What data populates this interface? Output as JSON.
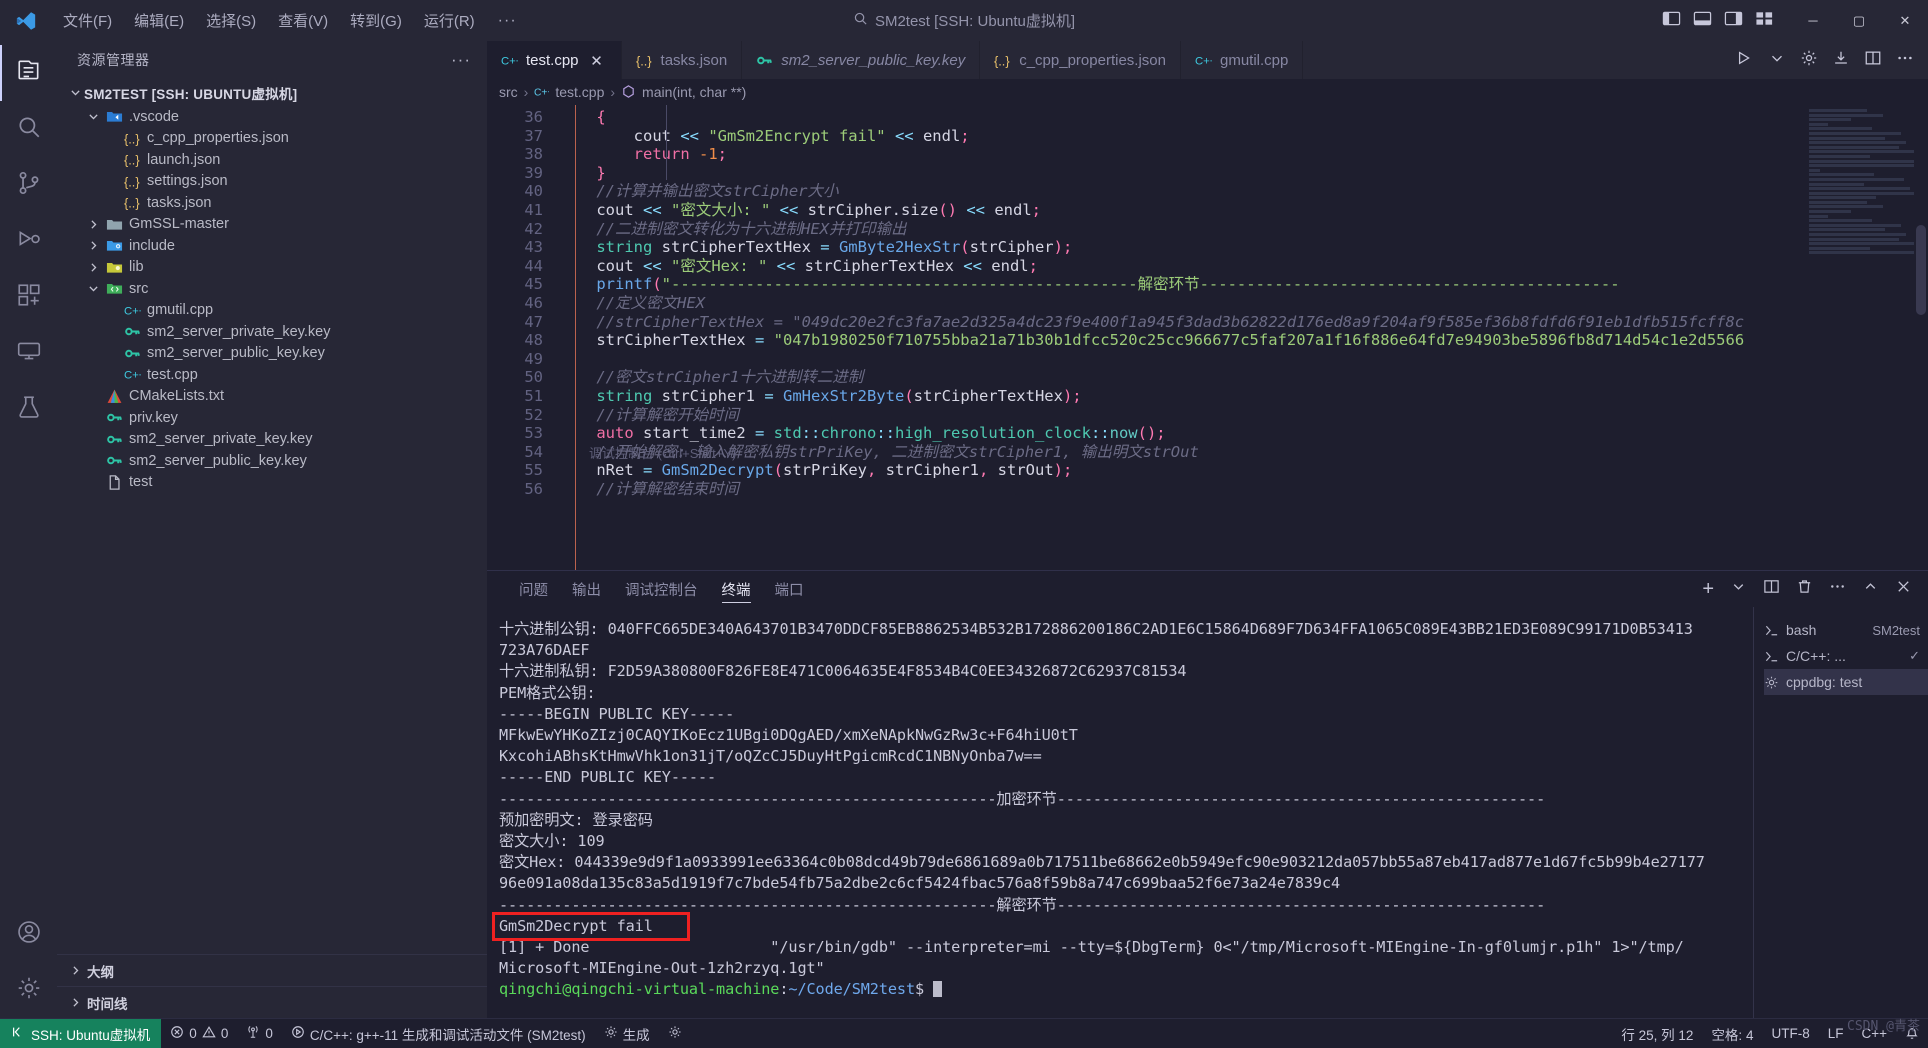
{
  "titlebar": {
    "menus": [
      "文件(F)",
      "编辑(E)",
      "选择(S)",
      "查看(V)",
      "转到(G)",
      "运行(R)"
    ],
    "more": "···",
    "center_title": "SM2test [SSH: Ubuntu虚拟机]",
    "search_icon": "search-icon",
    "window_buttons": {
      "minimize": "─",
      "maximize": "▢",
      "close": "✕"
    }
  },
  "activitybar": {
    "items": [
      {
        "name": "explorer",
        "icon": "files-icon",
        "active": true
      },
      {
        "name": "search",
        "icon": "search-icon",
        "active": false
      },
      {
        "name": "source-control",
        "icon": "source-control-icon",
        "active": false
      },
      {
        "name": "run-and-debug",
        "icon": "run-debug-icon",
        "active": false
      },
      {
        "name": "extensions",
        "icon": "extensions-icon",
        "active": false
      },
      {
        "name": "remote-explorer",
        "icon": "remote-explorer-icon",
        "active": false
      },
      {
        "name": "testing",
        "icon": "beaker-icon",
        "active": false
      }
    ],
    "bottom": [
      {
        "name": "accounts",
        "icon": "account-icon"
      },
      {
        "name": "manage",
        "icon": "gear-icon"
      }
    ]
  },
  "sidebar": {
    "title": "资源管理器",
    "more_actions": "···",
    "root": {
      "label": "SM2TEST [SSH: UBUNTU虚拟机]",
      "expanded": true
    },
    "tree": [
      {
        "label": ".vscode",
        "icon": "folder-vscode-icon",
        "indent": 1,
        "type": "folder",
        "expanded": true
      },
      {
        "label": "c_cpp_properties.json",
        "icon": "json-icon",
        "indent": 2,
        "type": "file"
      },
      {
        "label": "launch.json",
        "icon": "json-icon",
        "indent": 2,
        "type": "file"
      },
      {
        "label": "settings.json",
        "icon": "json-icon",
        "indent": 2,
        "type": "file"
      },
      {
        "label": "tasks.json",
        "icon": "json-icon",
        "indent": 2,
        "type": "file"
      },
      {
        "label": "GmSSL-master",
        "icon": "folder-icon",
        "indent": 1,
        "type": "folder",
        "expanded": false
      },
      {
        "label": "include",
        "icon": "folder-include-icon",
        "indent": 1,
        "type": "folder",
        "expanded": false
      },
      {
        "label": "lib",
        "icon": "folder-lib-icon",
        "indent": 1,
        "type": "folder",
        "expanded": false
      },
      {
        "label": "src",
        "icon": "folder-src-icon",
        "indent": 1,
        "type": "folder",
        "expanded": true
      },
      {
        "label": "gmutil.cpp",
        "icon": "cpp-icon",
        "indent": 2,
        "type": "file"
      },
      {
        "label": "sm2_server_private_key.key",
        "icon": "key-icon",
        "indent": 2,
        "type": "file"
      },
      {
        "label": "sm2_server_public_key.key",
        "icon": "key-icon",
        "indent": 2,
        "type": "file"
      },
      {
        "label": "test.cpp",
        "icon": "cpp-icon",
        "indent": 2,
        "type": "file"
      },
      {
        "label": "CMakeLists.txt",
        "icon": "cmake-icon",
        "indent": 1,
        "type": "file"
      },
      {
        "label": "priv.key",
        "icon": "key-icon",
        "indent": 1,
        "type": "file"
      },
      {
        "label": "sm2_server_private_key.key",
        "icon": "key-icon",
        "indent": 1,
        "type": "file"
      },
      {
        "label": "sm2_server_public_key.key",
        "icon": "key-icon",
        "indent": 1,
        "type": "file"
      },
      {
        "label": "test",
        "icon": "file-icon",
        "indent": 1,
        "type": "file"
      }
    ],
    "sections": [
      {
        "label": "大纲",
        "expanded": false
      },
      {
        "label": "时间线",
        "expanded": false
      }
    ]
  },
  "tabs": [
    {
      "label": "test.cpp",
      "icon": "cpp-icon",
      "active": true,
      "preview": false,
      "close": "✕"
    },
    {
      "label": "tasks.json",
      "icon": "json-icon",
      "active": false,
      "preview": false
    },
    {
      "label": "sm2_server_public_key.key",
      "icon": "key-icon",
      "active": false,
      "preview": true
    },
    {
      "label": "c_cpp_properties.json",
      "icon": "json-icon",
      "active": false,
      "preview": false
    },
    {
      "label": "gmutil.cpp",
      "icon": "cpp-icon",
      "active": false,
      "preview": false
    }
  ],
  "tabs_right": [
    "run-and-debug-icon",
    "chevron-down-icon",
    "gear-icon",
    "split-icon",
    "layout-icon",
    "more-icon"
  ],
  "breadcrumb": {
    "folder": "src",
    "file": "test.cpp",
    "symbol": "main(int, char **)"
  },
  "editor": {
    "first_line_number": 36,
    "lines": [
      {
        "n": 36,
        "tokens": [
          {
            "t": "    {",
            "c": "punct"
          }
        ]
      },
      {
        "n": 37,
        "tokens": [
          {
            "t": "        ",
            "c": "var"
          },
          {
            "t": "cout ",
            "c": "var"
          },
          {
            "t": "<< ",
            "c": "op"
          },
          {
            "t": "\"GmSm2Encrypt fail\" ",
            "c": "str"
          },
          {
            "t": "<< ",
            "c": "op"
          },
          {
            "t": "endl",
            "c": "var"
          },
          {
            "t": ";",
            "c": "punct"
          }
        ]
      },
      {
        "n": 38,
        "tokens": [
          {
            "t": "        ",
            "c": "var"
          },
          {
            "t": "return ",
            "c": "kw"
          },
          {
            "t": "-1",
            "c": "num"
          },
          {
            "t": ";",
            "c": "punct"
          }
        ]
      },
      {
        "n": 39,
        "tokens": [
          {
            "t": "    }",
            "c": "punct"
          }
        ]
      },
      {
        "n": 40,
        "tokens": [
          {
            "t": "    //计算并输出密文strCipher大小",
            "c": "cm"
          }
        ]
      },
      {
        "n": 41,
        "tokens": [
          {
            "t": "    cout ",
            "c": "var"
          },
          {
            "t": "<< ",
            "c": "op"
          },
          {
            "t": "\"密文大小: \" ",
            "c": "str"
          },
          {
            "t": "<< ",
            "c": "op"
          },
          {
            "t": "strCipher",
            "c": "var"
          },
          {
            "t": ".",
            "c": "var"
          },
          {
            "t": "size",
            "c": "var"
          },
          {
            "t": "()",
            "c": "punct"
          },
          {
            "t": " << ",
            "c": "op"
          },
          {
            "t": "endl",
            "c": "var"
          },
          {
            "t": ";",
            "c": "punct"
          }
        ]
      },
      {
        "n": 42,
        "tokens": [
          {
            "t": "    //二进制密文转化为十六进制HEX并打印输出",
            "c": "cm"
          }
        ]
      },
      {
        "n": 43,
        "tokens": [
          {
            "t": "    ",
            "c": "var"
          },
          {
            "t": "string ",
            "c": "type"
          },
          {
            "t": "strCipherTextHex ",
            "c": "var"
          },
          {
            "t": "= ",
            "c": "op"
          },
          {
            "t": "GmByte2HexStr",
            "c": "fn"
          },
          {
            "t": "(",
            "c": "punct"
          },
          {
            "t": "strCipher",
            "c": "var"
          },
          {
            "t": ");",
            "c": "punct"
          }
        ]
      },
      {
        "n": 44,
        "tokens": [
          {
            "t": "    cout ",
            "c": "var"
          },
          {
            "t": "<< ",
            "c": "op"
          },
          {
            "t": "\"密文Hex: \" ",
            "c": "str"
          },
          {
            "t": "<< ",
            "c": "op"
          },
          {
            "t": "strCipherTextHex ",
            "c": "var"
          },
          {
            "t": "<< ",
            "c": "op"
          },
          {
            "t": "endl",
            "c": "var"
          },
          {
            "t": ";",
            "c": "punct"
          }
        ]
      },
      {
        "n": 45,
        "tokens": [
          {
            "t": "    ",
            "c": "var"
          },
          {
            "t": "printf",
            "c": "fn"
          },
          {
            "t": "(",
            "c": "punct"
          },
          {
            "t": "\"--------------------------------------------------解密环节---------------------------------------------",
            "c": "str"
          }
        ]
      },
      {
        "n": 46,
        "tokens": [
          {
            "t": "    //定义密文HEX",
            "c": "cm"
          }
        ]
      },
      {
        "n": 47,
        "tokens": [
          {
            "t": "    //strCipherTextHex = \"049dc20e2fc3fa7ae2d325a4dc23f9e400f1a945f3dad3b62822d176ed8a9f204af9f585ef36b8fdfd6f91eb1dfb515fcff8c",
            "c": "cm"
          }
        ]
      },
      {
        "n": 48,
        "tokens": [
          {
            "t": "    strCipherTextHex ",
            "c": "var"
          },
          {
            "t": "= ",
            "c": "op"
          },
          {
            "t": "\"047b1980250f710755bba21a71b30b1dfcc520c25cc966677c5faf207a1f16f886e64fd7e94903be5896fb8d714d54c1e2d5566",
            "c": "str"
          }
        ]
      },
      {
        "n": 49,
        "tokens": [
          {
            "t": "",
            "c": "var"
          }
        ]
      },
      {
        "n": 50,
        "tokens": [
          {
            "t": "    //密文strCipher1十六进制转二进制",
            "c": "cm"
          }
        ]
      },
      {
        "n": 51,
        "tokens": [
          {
            "t": "    ",
            "c": "var"
          },
          {
            "t": "string ",
            "c": "type"
          },
          {
            "t": "strCipher1 ",
            "c": "var"
          },
          {
            "t": "= ",
            "c": "op"
          },
          {
            "t": "GmHexStr2Byte",
            "c": "fn"
          },
          {
            "t": "(",
            "c": "punct"
          },
          {
            "t": "strCipherTextHex",
            "c": "var"
          },
          {
            "t": ");",
            "c": "punct"
          }
        ]
      },
      {
        "n": 52,
        "tokens": [
          {
            "t": "    //计算解密开始时间",
            "c": "cm"
          }
        ]
      },
      {
        "n": 53,
        "tokens": [
          {
            "t": "    ",
            "c": "var"
          },
          {
            "t": "auto ",
            "c": "kw"
          },
          {
            "t": "start_time2 ",
            "c": "var"
          },
          {
            "t": "= ",
            "c": "op"
          },
          {
            "t": "std",
            "c": "type"
          },
          {
            "t": "::",
            "c": "op"
          },
          {
            "t": "chrono",
            "c": "type"
          },
          {
            "t": "::",
            "c": "op"
          },
          {
            "t": "high_resolution_clock",
            "c": "type"
          },
          {
            "t": "::",
            "c": "op"
          },
          {
            "t": "now",
            "c": "fn2"
          },
          {
            "t": "();",
            "c": "punct"
          }
        ]
      },
      {
        "n": 54,
        "tokens": [
          {
            "t": "    //开始解密: 输入解密私钥strPriKey, 二进制密文strCipher1, 输出明文strOut",
            "c": "cm"
          }
        ]
      },
      {
        "n": 55,
        "tokens": [
          {
            "t": "    ",
            "c": "var"
          },
          {
            "t": "nRet ",
            "c": "var"
          },
          {
            "t": "= ",
            "c": "op"
          },
          {
            "t": "GmSm2Decrypt",
            "c": "fn"
          },
          {
            "t": "(",
            "c": "punct"
          },
          {
            "t": "strPriKey",
            "c": "var"
          },
          {
            "t": ", ",
            "c": "punct"
          },
          {
            "t": "strCipher1",
            "c": "var"
          },
          {
            "t": ", ",
            "c": "punct"
          },
          {
            "t": "strOut",
            "c": "var"
          },
          {
            "t": ");",
            "c": "punct"
          }
        ]
      },
      {
        "n": 56,
        "tokens": [
          {
            "t": "    //计算解密结束时间",
            "c": "cm"
          }
        ]
      }
    ],
    "debug_hint": "调试控制台 (Ctrl+Shift+Y)"
  },
  "panel": {
    "tabs": [
      {
        "label": "问题",
        "active": false
      },
      {
        "label": "输出",
        "active": false
      },
      {
        "label": "调试控制台",
        "active": false
      },
      {
        "label": "终端",
        "active": true
      },
      {
        "label": "端口",
        "active": false
      }
    ],
    "actions": [
      "add-terminal-icon",
      "split-terminal-icon",
      "more-icon",
      "chevron-up-icon",
      "close-icon"
    ],
    "terminal_lines": [
      "十六进制公钥: 040FFC665DE340A643701B3470DDCF85EB8862534B532B172886200186C2AD1E6C15864D689F7D634FFA1065C089E43BB21ED3E089C99171D0B53413",
      "723A76DAEF",
      "十六进制私钥: F2D59A380800F826FE8E471C0064635E4F8534B4C0EE34326872C62937C81534",
      "PEM格式公钥:",
      "-----BEGIN PUBLIC KEY-----",
      "MFkwEwYHKoZIzj0CAQYIKoEcz1UBgi0DQgAED/xmXeNApkNwGzRw3c+F64hiU0tT",
      "KxcohiABhsKtHmwVhk1on31jT/oQZcCJ5DuyHtPgicmRcdC1NBNyOnba7w==",
      "-----END PUBLIC KEY-----",
      "",
      "-------------------------------------------------------加密环节------------------------------------------------------",
      "预加密明文: 登录密码",
      "密文大小: 109",
      "密文Hex: 044339e9d9f1a0933991ee63364c0b08dcd49b79de6861689a0b717511be68662e0b5949efc90e903212da057bb55a87eb417ad877e1d67fc5b99b4e27177",
      "96e091a08da135c83a5d1919f7c7bde54fb75a2dbe2c6cf5424fbac576a8f59b8a747c699baa52f6e73a24e7839c4",
      "-------------------------------------------------------解密环节------------------------------------------------------",
      "GmSm2Decrypt fail"
    ],
    "done_line": "[1] + Done                    \"/usr/bin/gdb\" --interpreter=mi --tty=${DbgTerm} 0<\"/tmp/Microsoft-MIEngine-In-gf0lumjr.p1h\" 1>\"/tmp/",
    "done_line2": "Microsoft-MIEngine-Out-1zh2rzyq.1gt\"",
    "prompt_user": "qingchi@qingchi-virtual-machine",
    "prompt_sep": ":",
    "prompt_path": "~/Code/SM2test",
    "prompt_tail": "$",
    "highlight_color": "#ef2121",
    "terminal_list": [
      {
        "label": "bash",
        "suffix": "SM2test",
        "icon": "terminal-icon",
        "active": false
      },
      {
        "label": "C/C++: ...",
        "suffix": "",
        "icon": "terminal-icon",
        "active": false,
        "check": "✓"
      },
      {
        "label": "cppdbg: test",
        "suffix": "",
        "icon": "gear-icon",
        "active": true
      }
    ]
  },
  "statusbar": {
    "remote": "SSH: Ubuntu虚拟机",
    "errors": "0",
    "warnings": "0",
    "radio_tower": "0",
    "build_task": "C/C++: g++-11 生成和调试活动文件 (SM2test)",
    "gear_build": "生成",
    "settings_icon": "gear-icon",
    "right_items": [
      "行 25, 列 12",
      "空格: 4",
      "UTF-8",
      "LF",
      "C++",
      "bell-icon"
    ],
    "watermark": "CSDN @青茶"
  }
}
